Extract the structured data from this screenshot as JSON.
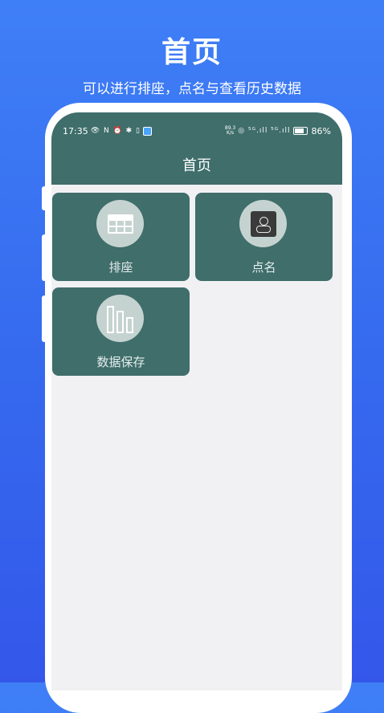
{
  "promo": {
    "title": "首页",
    "subtitle": "可以进行排座，点名与查看历史数据"
  },
  "status_bar": {
    "time": "17:35",
    "left_icons": "👁 N ⏰ ✱ ▯",
    "net_speed_value": "89.3",
    "net_speed_unit": "K/s",
    "right_icons": "◎ ⁵ᴳ.ıll ⁵ᴳ.ıll",
    "battery": "86%"
  },
  "appbar": {
    "title": "首页"
  },
  "tiles": [
    {
      "label": "排座",
      "icon": "grid-icon"
    },
    {
      "label": "点名",
      "icon": "contact-card-icon"
    },
    {
      "label": "数据保存",
      "icon": "bar-chart-icon"
    }
  ],
  "colors": {
    "background": "#3f7ff6",
    "primary": "#3f6e6b",
    "screen_background": "#f1f1f3",
    "icon_circle": "#c5d3d0"
  }
}
